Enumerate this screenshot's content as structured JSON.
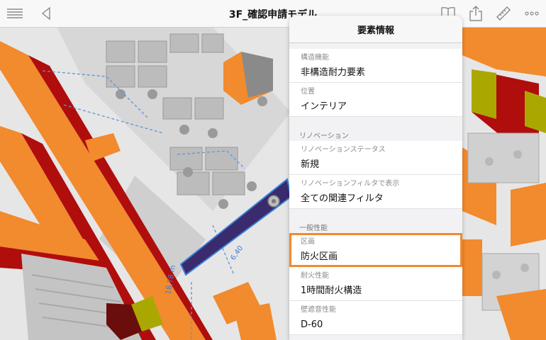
{
  "app": {
    "title": "3F_確認申請モデル"
  },
  "panel": {
    "title": "要素情報",
    "top_rows": [
      {
        "label": "構造機能",
        "value": "非構造耐力要素"
      },
      {
        "label": "位置",
        "value": "インテリア"
      }
    ],
    "renovation": {
      "header": "リノベーション",
      "rows": [
        {
          "label": "リノベーションステータス",
          "value": "新規"
        },
        {
          "label": "リノベーションフィルタで表示",
          "value": "全ての関連フィルタ"
        }
      ]
    },
    "general": {
      "header": "一般性能",
      "rows": [
        {
          "label": "区画",
          "value": "防火区画"
        },
        {
          "label": "耐火性能",
          "value": "1時間耐火構造"
        },
        {
          "label": "壁遮音性能",
          "value": "D-60"
        }
      ]
    }
  },
  "drawing": {
    "dim_labels": [
      "6,40",
      "18,78 m"
    ],
    "colors": {
      "orange": "#f28a2e",
      "red": "#b00d0d",
      "purple": "#3a2a6e",
      "olive": "#aaa800",
      "blue": "#3b7fd6"
    }
  }
}
